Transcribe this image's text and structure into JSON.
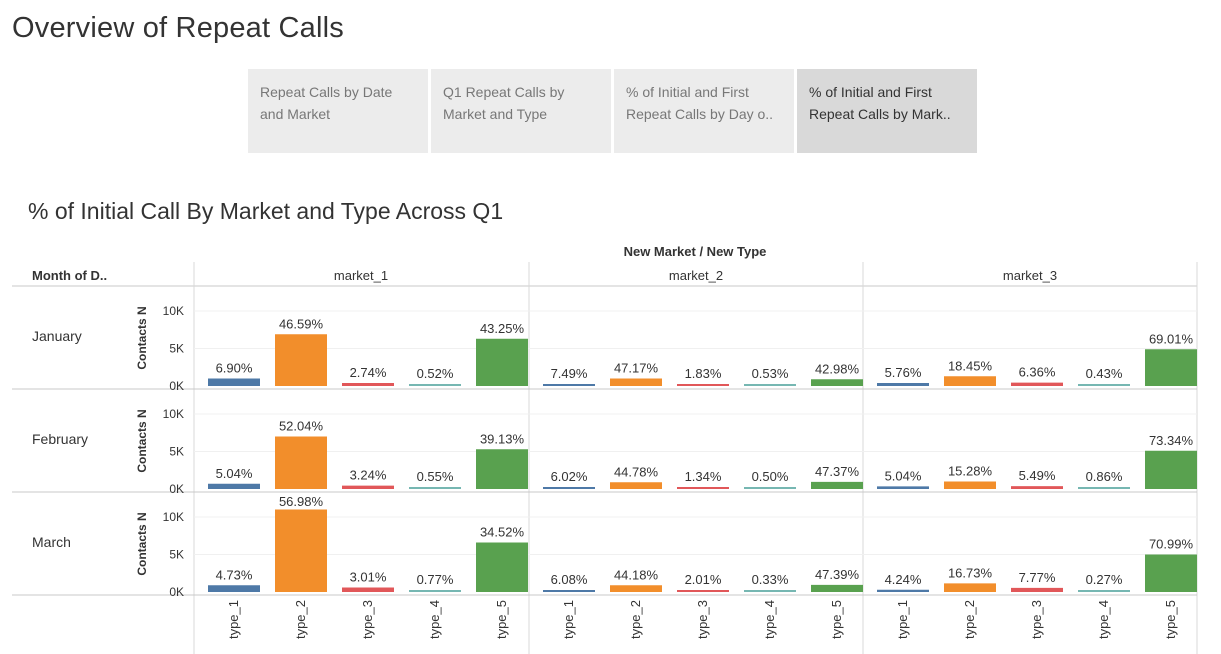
{
  "dashboard": {
    "title": "Overview of Repeat Calls",
    "tabs": [
      {
        "label": "Repeat Calls by Date and Market",
        "active": false
      },
      {
        "label": "Q1 Repeat Calls by Market and Type",
        "active": false
      },
      {
        "label": "% of Initial and First Repeat Calls by Day o..",
        "active": false
      },
      {
        "label": "% of Initial and First Repeat Calls by Mark..",
        "active": true
      }
    ]
  },
  "chart_data": {
    "type": "bar",
    "title": "% of Initial Call By Market and Type Across Q1",
    "column_header": "New Market / New Type",
    "row_header": "Month of D..",
    "ylabel": "Contacts N",
    "ylim": [
      0,
      12000
    ],
    "yticks": [
      0,
      5000,
      10000
    ],
    "ytick_labels": [
      "0K",
      "5K",
      "10K"
    ],
    "markets": [
      "market_1",
      "market_2",
      "market_3"
    ],
    "types": [
      "type_1",
      "type_2",
      "type_3",
      "type_4",
      "type_5"
    ],
    "type_colors": {
      "type_1": "#4e79a7",
      "type_2": "#f28e2b",
      "type_3": "#e15759",
      "type_4": "#76b7b2",
      "type_5": "#59a14f"
    },
    "months": [
      "January",
      "February",
      "March"
    ],
    "panels": [
      {
        "month": "January",
        "market": "market_1",
        "values": [
          1000,
          6900,
          400,
          80,
          6300
        ],
        "labels": [
          "6.90%",
          "46.59%",
          "2.74%",
          "0.52%",
          "43.25%"
        ]
      },
      {
        "month": "January",
        "market": "market_2",
        "values": [
          150,
          1000,
          60,
          20,
          900
        ],
        "labels": [
          "7.49%",
          "47.17%",
          "1.83%",
          "0.53%",
          "42.98%"
        ]
      },
      {
        "month": "January",
        "market": "market_3",
        "values": [
          400,
          1300,
          450,
          30,
          4900
        ],
        "labels": [
          "5.76%",
          "18.45%",
          "6.36%",
          "0.43%",
          "69.01%"
        ]
      },
      {
        "month": "February",
        "market": "market_1",
        "values": [
          700,
          7000,
          450,
          80,
          5300
        ],
        "labels": [
          "5.04%",
          "52.04%",
          "3.24%",
          "0.55%",
          "39.13%"
        ]
      },
      {
        "month": "February",
        "market": "market_2",
        "values": [
          120,
          900,
          30,
          10,
          950
        ],
        "labels": [
          "6.02%",
          "44.78%",
          "1.34%",
          "0.50%",
          "47.37%"
        ]
      },
      {
        "month": "February",
        "market": "market_3",
        "values": [
          350,
          1000,
          380,
          60,
          5100
        ],
        "labels": [
          "5.04%",
          "15.28%",
          "5.49%",
          "0.86%",
          "73.34%"
        ]
      },
      {
        "month": "March",
        "market": "market_1",
        "values": [
          900,
          11000,
          600,
          150,
          6600
        ],
        "labels": [
          "4.73%",
          "56.98%",
          "3.01%",
          "0.77%",
          "34.52%"
        ]
      },
      {
        "month": "March",
        "market": "market_2",
        "values": [
          120,
          900,
          40,
          10,
          950
        ],
        "labels": [
          "6.08%",
          "44.18%",
          "2.01%",
          "0.33%",
          "47.39%"
        ]
      },
      {
        "month": "March",
        "market": "market_3",
        "values": [
          300,
          1150,
          550,
          20,
          5000
        ],
        "labels": [
          "4.24%",
          "16.73%",
          "7.77%",
          "0.27%",
          "70.99%"
        ]
      }
    ]
  }
}
